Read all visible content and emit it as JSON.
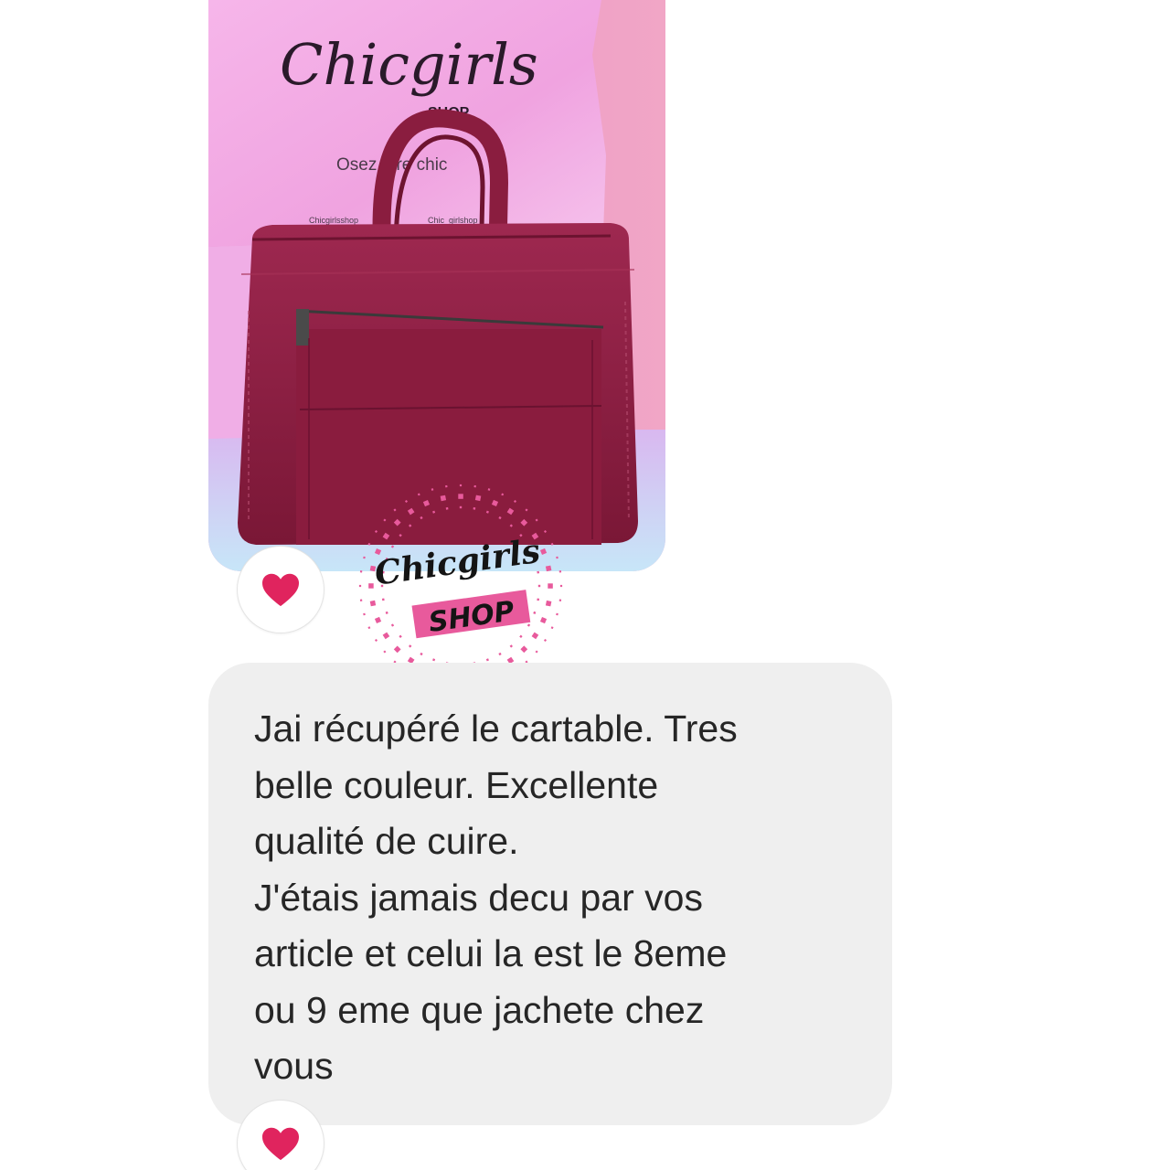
{
  "photo": {
    "subject": "burgundy leather briefcase on pink shop bag",
    "bag_brand": "Chicgirls",
    "bag_brand_sub": "SHOP",
    "bag_tagline": "Osez être chic",
    "bag_social_1": "Chicgirlsshop",
    "bag_social_2": "Chic_girlshop"
  },
  "reactions": [
    {
      "icon": "heart-icon",
      "color": "#e0245e"
    },
    {
      "icon": "heart-icon",
      "color": "#e0245e"
    }
  ],
  "watermark": {
    "title": "Chicgirls",
    "subtitle": "SHOP",
    "accent_color": "#e85a9c"
  },
  "message": {
    "text": "Jai récupéré le cartable. Tres\nbelle couleur. Excellente\nqualité de cuire.\nJ'étais jamais decu par vos\narticle et celui la est le 8eme\nou 9 eme que jachete chez\nvous"
  },
  "colors": {
    "bubble_background": "#efefef",
    "text": "#262626",
    "bag_pink": "#f2a9e0",
    "briefcase": "#8d1e3f"
  }
}
